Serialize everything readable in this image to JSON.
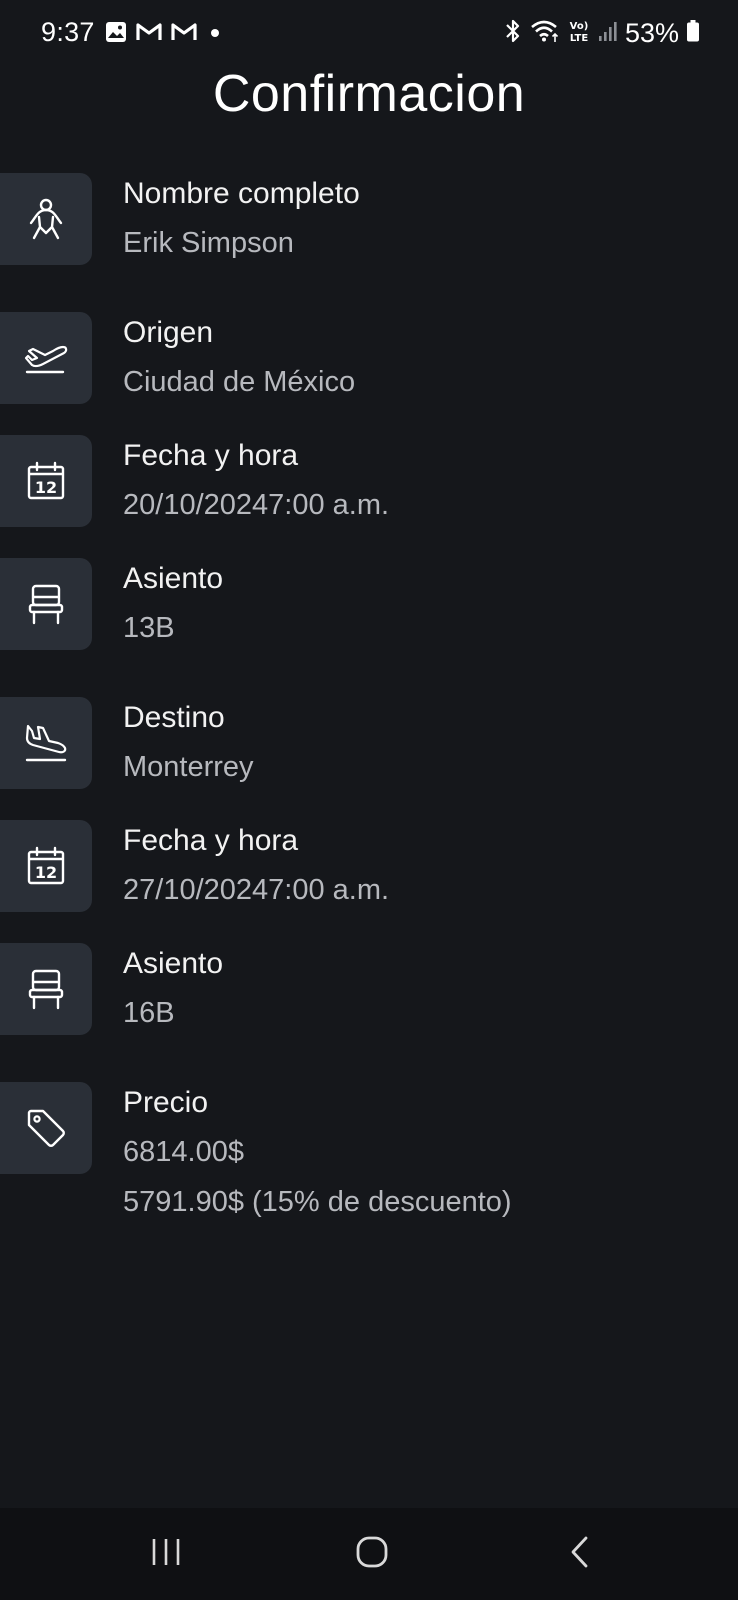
{
  "status_bar": {
    "time": "9:37",
    "battery": "53%",
    "left_icons": [
      "gallery-icon",
      "gmail-icon",
      "gmail-icon",
      "dot-icon"
    ],
    "right_icons": [
      "bluetooth-icon",
      "wifi-icon",
      "volte-icon",
      "signal-icon",
      "battery-icon"
    ]
  },
  "title": "Confirmacion",
  "rows": [
    {
      "icon": "person-icon",
      "label": "Nombre completo",
      "value": "Erik Simpson"
    },
    {
      "icon": "takeoff-icon",
      "label": "Origen",
      "value": "Ciudad de México"
    },
    {
      "icon": "calendar-icon",
      "calendar_day": "12",
      "label": "Fecha y hora",
      "value": "20/10/20247:00 a.m."
    },
    {
      "icon": "seat-icon",
      "label": "Asiento",
      "value": "13B"
    },
    {
      "icon": "landing-icon",
      "label": "Destino",
      "value": "Monterrey"
    },
    {
      "icon": "calendar-icon",
      "calendar_day": "12",
      "label": "Fecha y hora",
      "value": "27/10/20247:00 a.m."
    },
    {
      "icon": "seat-icon",
      "label": "Asiento",
      "value": "16B"
    },
    {
      "icon": "tag-icon",
      "label": "Precio",
      "value": "6814.00$",
      "value2": "5791.90$ (15% de descuento)"
    }
  ],
  "nav": [
    "recent-apps-icon",
    "home-icon",
    "back-icon"
  ],
  "colors": {
    "background": "#15171b",
    "icon_box": "#2a2f37",
    "label": "#f2f2f2",
    "value": "#b7b9be",
    "nav_bar": "#0f1013"
  }
}
